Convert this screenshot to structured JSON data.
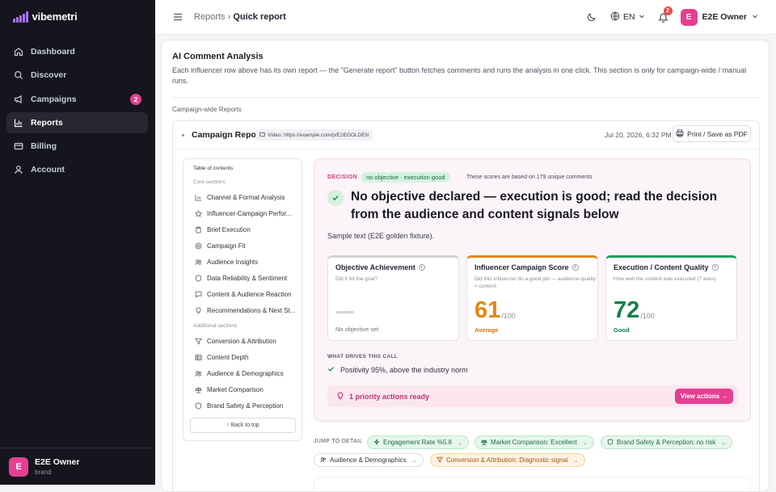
{
  "brand": {
    "name": "vibemetri"
  },
  "nav": {
    "items": [
      {
        "label": "Dashboard"
      },
      {
        "label": "Discover"
      },
      {
        "label": "Campaigns",
        "badge": "2"
      },
      {
        "label": "Reports"
      },
      {
        "label": "Billing"
      },
      {
        "label": "Account"
      }
    ]
  },
  "sidebar_user": {
    "initial": "E",
    "name": "E2E Owner",
    "role": "brand"
  },
  "topbar": {
    "breadcrumb_parent": "Reports",
    "breadcrumb_sep": "›",
    "breadcrumb_current": "Quick report",
    "lang": "EN",
    "notif_count": "2",
    "user_initial": "E",
    "user_name": "E2E Owner"
  },
  "ai": {
    "title": "AI Comment Analysis",
    "desc": "Each influencer row above has its own report — the \"Generate report\" button fetches comments and runs the analysis in one click. This section is only for campaign-wide / manual runs.",
    "campaign_wide_label": "Campaign-wide Reports"
  },
  "report": {
    "title": "Campaign Report",
    "video": "Video: https://example.com/p/E2EGOLDEN",
    "date": "Jul 20, 2026, 6:32 PM",
    "print_label": "Print / Save as PDF"
  },
  "toc": {
    "title": "Table of contents",
    "core_label": "Core sections",
    "core": [
      {
        "label": "Channel & Format Analysis"
      },
      {
        "label": "Influencer-Campaign Perfor..."
      },
      {
        "label": "Brief Execution"
      },
      {
        "label": "Campaign Fit"
      },
      {
        "label": "Audience Insights"
      },
      {
        "label": "Data Reliability & Sentiment"
      },
      {
        "label": "Content & Audience Reaction"
      },
      {
        "label": "Recommendations & Next St..."
      }
    ],
    "additional_label": "Additional sections",
    "additional": [
      {
        "label": "Conversion & Attribution"
      },
      {
        "label": "Content Depth"
      },
      {
        "label": "Audience & Demographics"
      },
      {
        "label": "Market Comparison"
      },
      {
        "label": "Brand Safety & Perception"
      }
    ],
    "back_label": "↑ Back to top"
  },
  "decision": {
    "label": "DECISION",
    "pill": "no objective · execution good",
    "note": "These scores are based on 179 unique comments",
    "headline": "No objective declared — execution is good; read the decision from the audience and content signals below",
    "sample": "Sample text (E2E golden fixture).",
    "cards": [
      {
        "title": "Objective Achievement",
        "subtitle": "Did it hit the goal?",
        "empty_label": "No objective set",
        "accent": "#d2d4da"
      },
      {
        "title": "Influencer Campaign Score",
        "subtitle": "Did this influencer do a good job — audience quality + content",
        "score": "61",
        "denominator": "/100",
        "rating": "Average",
        "accent": "#e8850c"
      },
      {
        "title": "Execution / Content Quality",
        "subtitle": "How well the content was executed (7 axes)",
        "score": "72",
        "denominator": "/100",
        "rating": "Good",
        "accent": "#17a05a"
      }
    ],
    "drives_label": "WHAT DRIVES THIS CALL",
    "drives": [
      {
        "text": "Positivity 95%, above the industry norm"
      }
    ],
    "priority_text": "1 priority actions ready",
    "view_actions": "View actions →"
  },
  "jump": {
    "label": "JUMP TO DETAIL",
    "chips": [
      {
        "label": "Engagement Rate %5.8"
      },
      {
        "label": "Market Comparison: Excellent"
      },
      {
        "label": "Brand Safety & Perception: no risk"
      },
      {
        "label": "Audience & Demographics"
      },
      {
        "label": "Conversion & Attribution: Diagnostic signal"
      }
    ]
  }
}
